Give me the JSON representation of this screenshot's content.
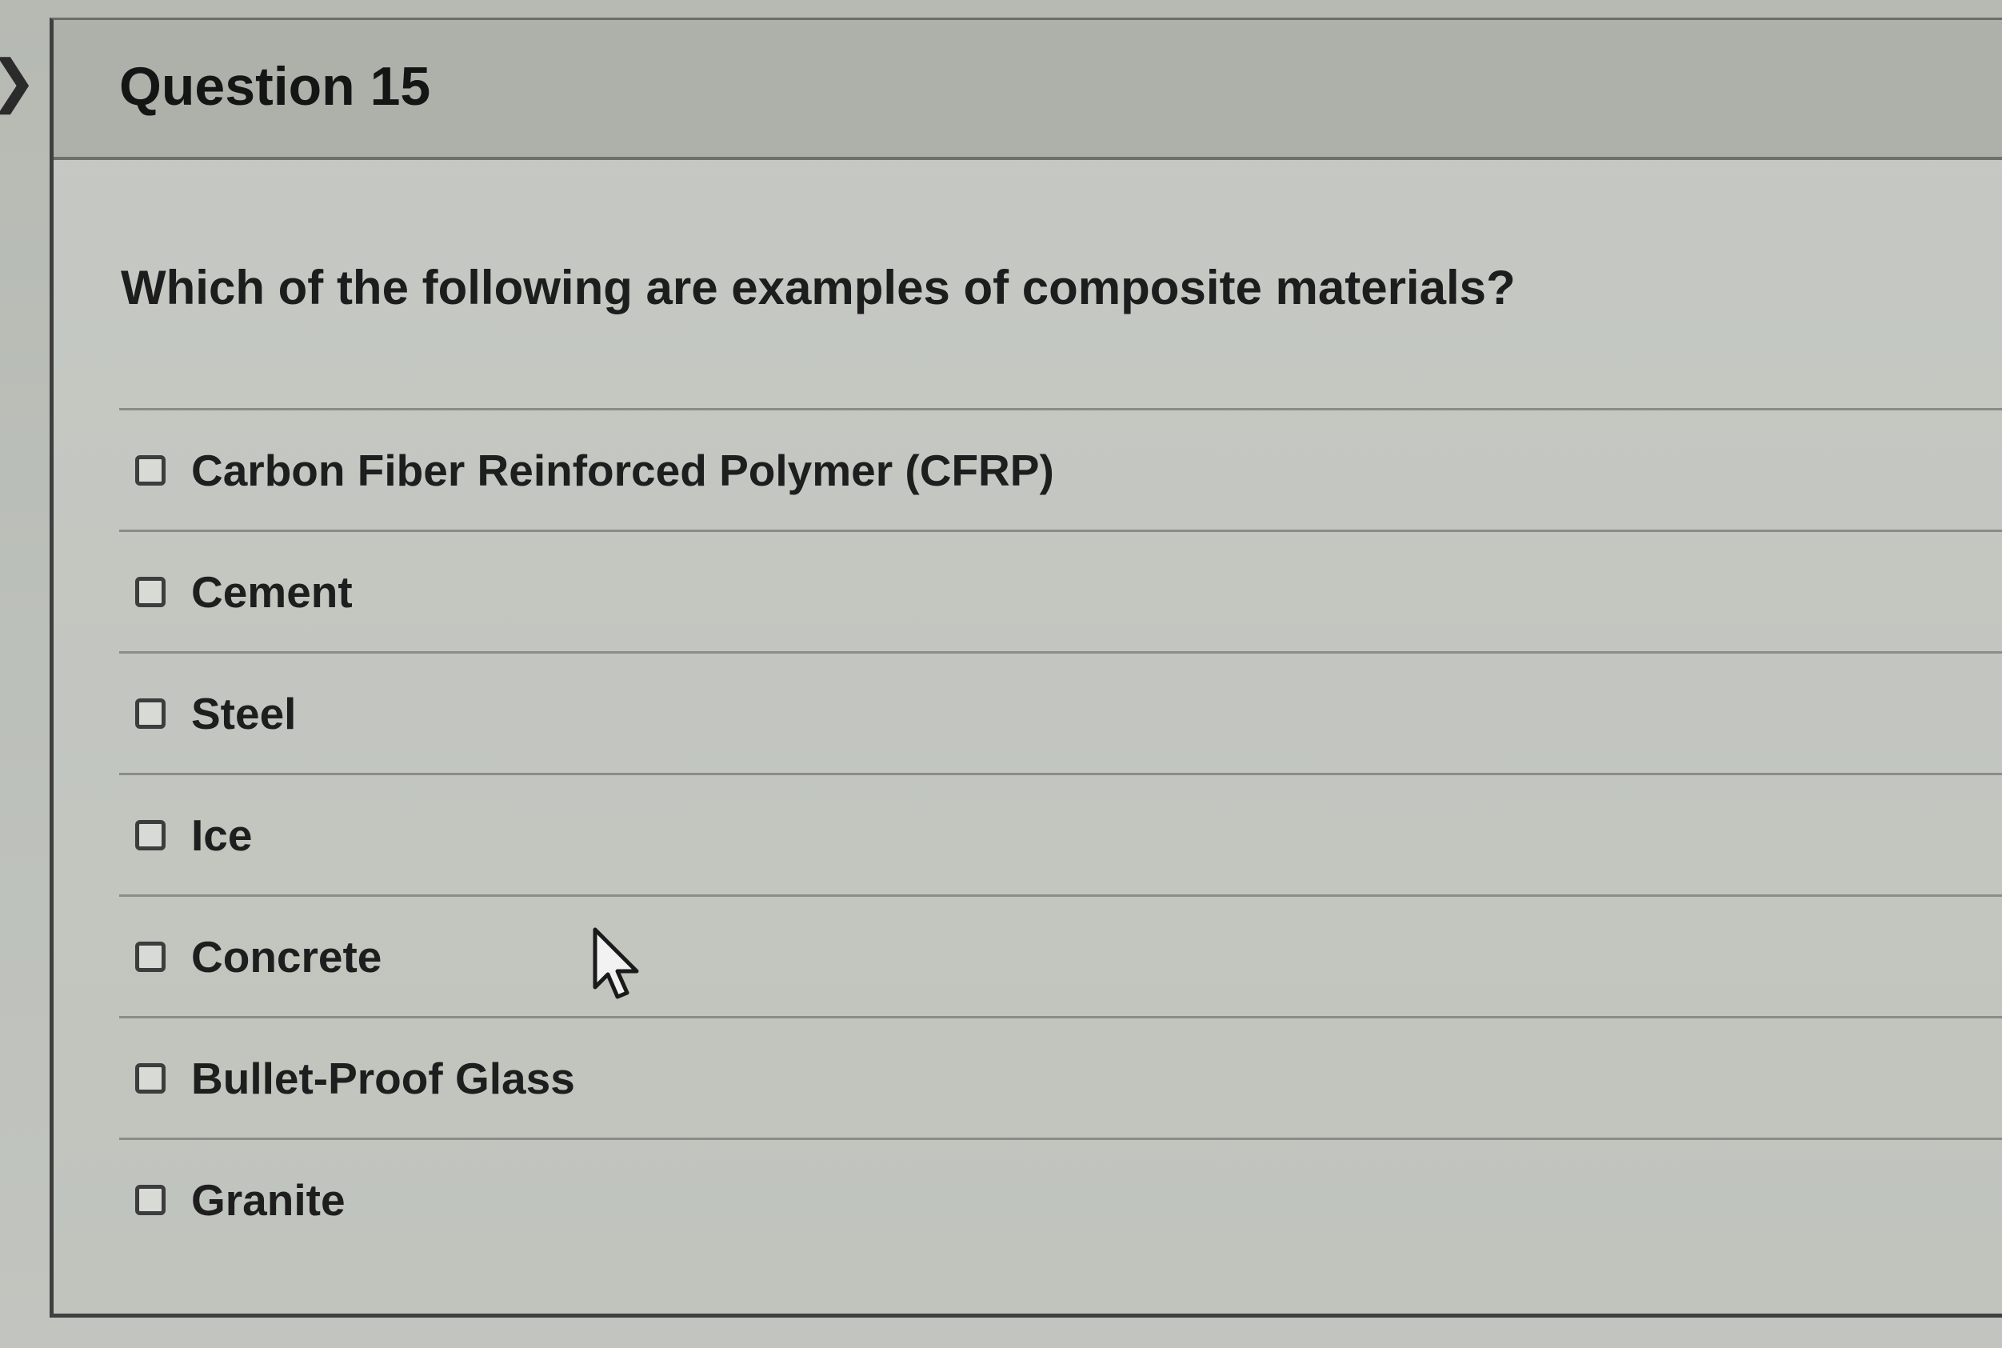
{
  "question": {
    "title": "Question 15",
    "prompt": "Which of the following are examples of composite materials?",
    "options": [
      {
        "label": "Carbon Fiber Reinforced Polymer (CFRP)",
        "checked": false
      },
      {
        "label": "Cement",
        "checked": false
      },
      {
        "label": "Steel",
        "checked": false
      },
      {
        "label": "Ice",
        "checked": false
      },
      {
        "label": "Concrete",
        "checked": false
      },
      {
        "label": "Bullet-Proof Glass",
        "checked": false
      },
      {
        "label": "Granite",
        "checked": false
      }
    ]
  },
  "icons": {
    "collapse": "chevron-right-icon",
    "cursor": "mouse-pointer-icon"
  },
  "colors": {
    "background": "#bcc0ba",
    "text": "#1d1d1d",
    "border": "#3f3f3f"
  }
}
